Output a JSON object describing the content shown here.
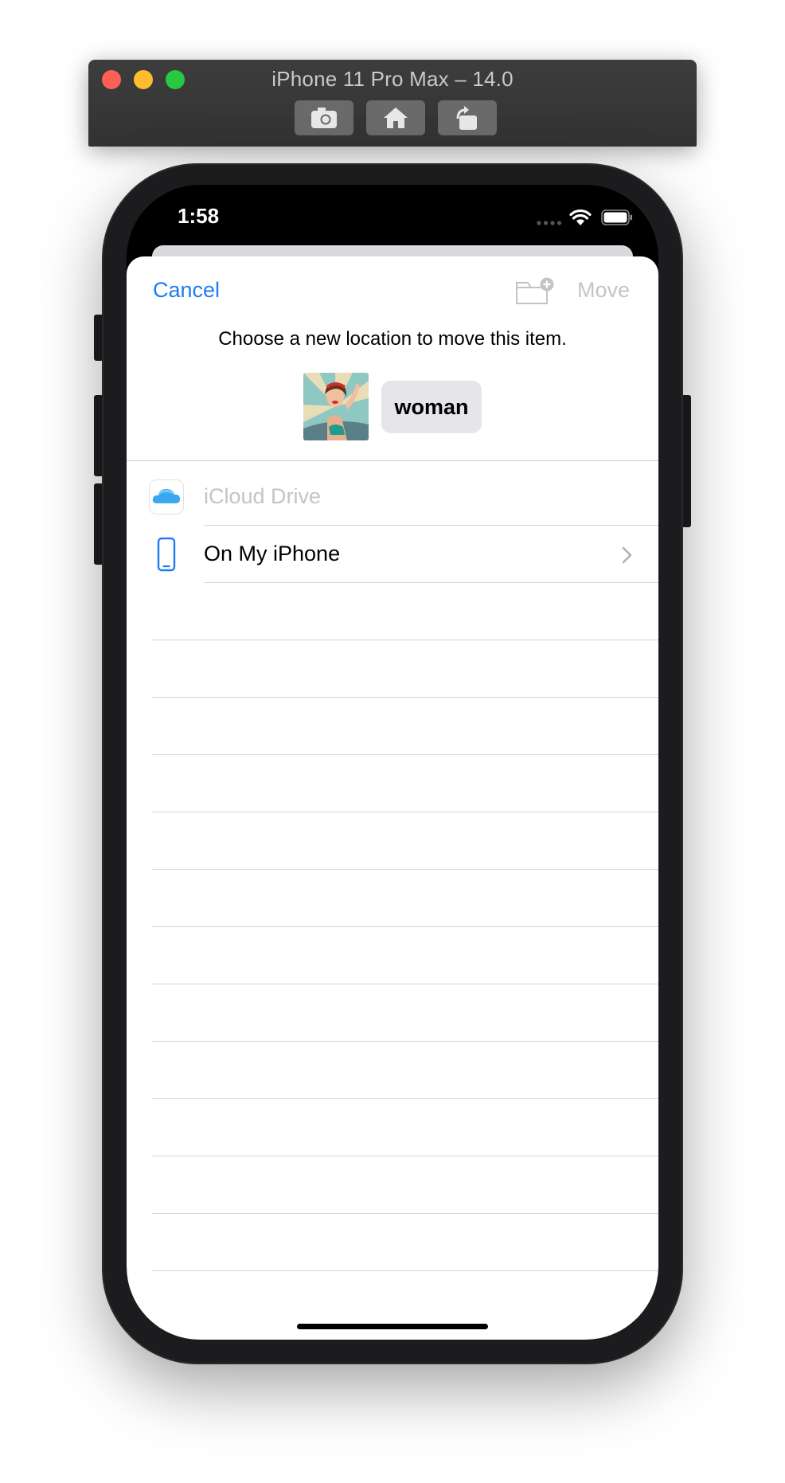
{
  "simulator": {
    "title": "iPhone 11 Pro Max – 14.0",
    "buttons": [
      "screenshot-icon",
      "home-icon",
      "rotate-icon"
    ]
  },
  "status_bar": {
    "time": "1:58"
  },
  "nav": {
    "cancel_label": "Cancel",
    "move_label": "Move",
    "new_folder_icon": "new-folder-icon"
  },
  "header": {
    "instruction": "Choose a new location to move this item.",
    "file_name": "woman"
  },
  "locations": [
    {
      "label": "iCloud Drive",
      "icon": "icloud-icon",
      "enabled": false
    },
    {
      "label": "On My iPhone",
      "icon": "iphone-icon",
      "enabled": true
    }
  ],
  "colors": {
    "accent": "#1e7cf2",
    "disabled": "#c4c4c6"
  }
}
